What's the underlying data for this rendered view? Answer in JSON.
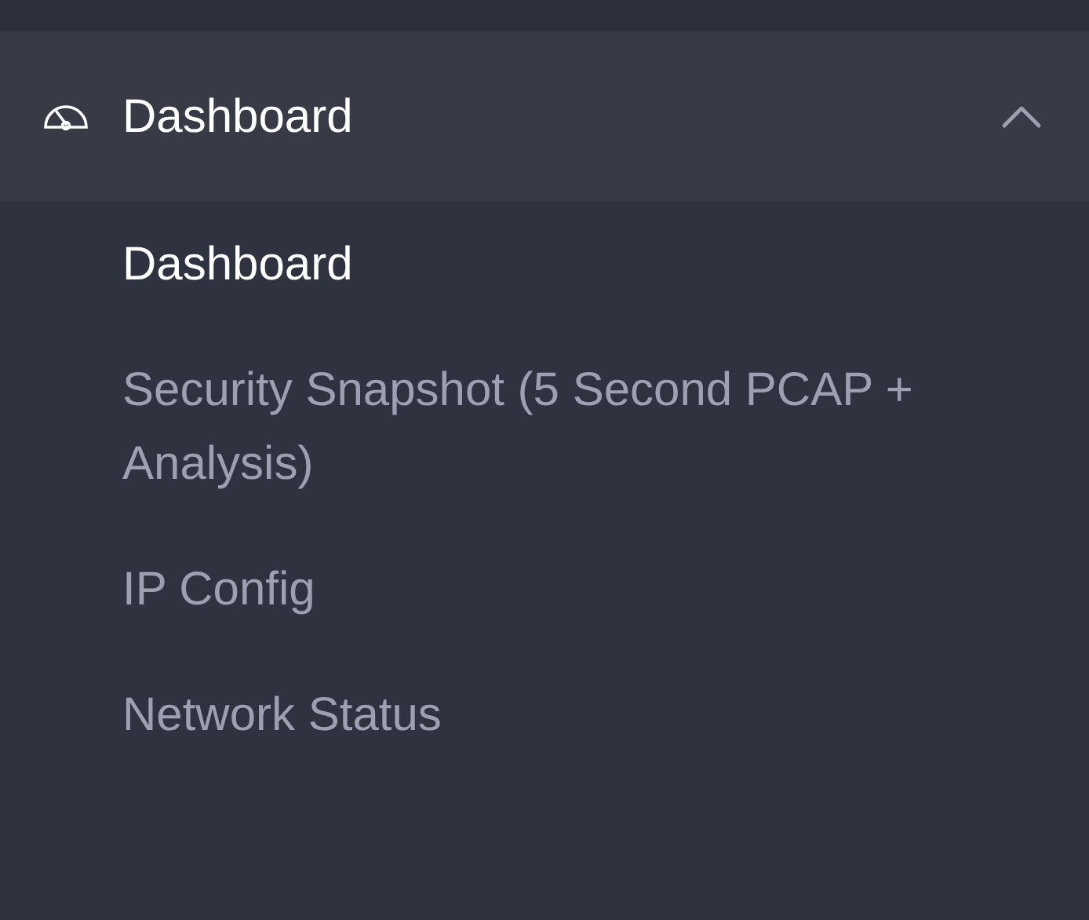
{
  "menu": {
    "title": "Dashboard",
    "expanded": true,
    "items": [
      {
        "label": "Dashboard",
        "selected": true
      },
      {
        "label": "Security Snapshot (5 Second PCAP + Analysis)",
        "selected": false
      },
      {
        "label": "IP Config",
        "selected": false
      },
      {
        "label": "Network Status",
        "selected": false
      }
    ]
  }
}
